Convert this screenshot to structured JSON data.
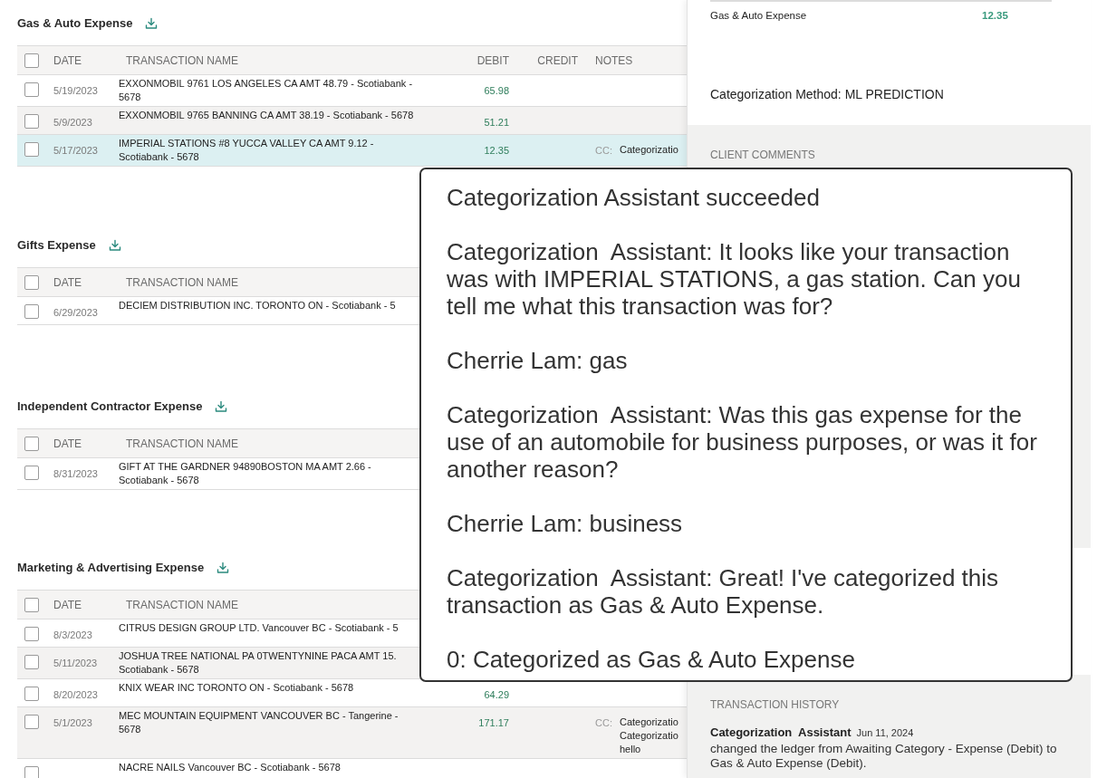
{
  "sections": [
    {
      "title": "Gas & Auto Expense",
      "columns": [
        "DATE",
        "TRANSACTION NAME",
        "DEBIT",
        "CREDIT",
        "NOTES"
      ],
      "header_checked": false,
      "rows": [
        {
          "date": "5/19/2023",
          "name": [
            "EXXONMOBIL 9761 LOS ANGELES CA AMT 48.79 - Scotiabank -",
            "5678"
          ],
          "debit": "65.98",
          "notes_label": "",
          "notes": [],
          "checked": false,
          "selected": false
        },
        {
          "date": "5/9/2023",
          "name": [
            "EXXONMOBIL 9765 BANNING CA AMT 38.19 - Scotiabank - 5678"
          ],
          "debit": "51.21",
          "notes_label": "",
          "notes": [],
          "checked": false,
          "selected": false
        },
        {
          "date": "5/17/2023",
          "name": [
            "IMPERIAL STATIONS #8 YUCCA VALLEY CA AMT 9.12 -",
            "Scotiabank - 5678"
          ],
          "debit": "12.35",
          "notes_label": "CC:",
          "notes": [
            "Categorizatio"
          ],
          "checked": false,
          "selected": true
        }
      ]
    },
    {
      "title": "Gifts Expense",
      "columns": [
        "DATE",
        "TRANSACTION NAME"
      ],
      "header_checked": false,
      "rows": [
        {
          "date": "6/29/2023",
          "name": [
            "DECIEM DISTRIBUTION INC. TORONTO ON - Scotiabank - 5"
          ],
          "debit": "",
          "notes_label": "",
          "notes": [],
          "checked": false,
          "selected": false
        }
      ]
    },
    {
      "title": "Independent Contractor Expense",
      "columns": [
        "DATE",
        "TRANSACTION NAME"
      ],
      "header_checked": false,
      "rows": [
        {
          "date": "8/31/2023",
          "name": [
            "GIFT AT THE GARDNER 94890BOSTON MA AMT 2.66 -",
            "Scotiabank - 5678"
          ],
          "debit": "",
          "notes_label": "",
          "notes": [],
          "checked": false,
          "selected": false
        }
      ]
    },
    {
      "title": "Marketing & Advertising Expense",
      "columns": [
        "DATE",
        "TRANSACTION NAME"
      ],
      "header_checked": false,
      "rows": [
        {
          "date": "8/3/2023",
          "name": [
            "CITRUS DESIGN GROUP LTD. Vancouver BC - Scotiabank - 5"
          ],
          "debit": "",
          "notes_label": "",
          "notes": [],
          "checked": false,
          "selected": false
        },
        {
          "date": "5/11/2023",
          "name": [
            "JOSHUA TREE NATIONAL PA 0TWENTYNINE PACA AMT 15.",
            "Scotiabank - 5678"
          ],
          "debit": "",
          "notes_label": "",
          "notes": [],
          "checked": false,
          "selected": false
        },
        {
          "date": "8/20/2023",
          "name": [
            "KNIX WEAR INC TORONTO ON - Scotiabank - 5678"
          ],
          "debit": "64.29",
          "notes_label": "",
          "notes": [],
          "checked": false,
          "selected": false
        },
        {
          "date": "5/1/2023",
          "name": [
            "MEC MOUNTAIN EQUIPMENT VANCOUVER BC - Tangerine -",
            "5678"
          ],
          "debit": "171.17",
          "notes_label": "CC:",
          "notes": [
            "Categorizatio",
            "Categorizatio",
            "hello"
          ],
          "checked": false,
          "selected": false
        },
        {
          "date": "",
          "name": [
            "NACRE NAILS Vancouver BC - Scotiabank - 5678"
          ],
          "debit": "",
          "notes_label": "",
          "notes": [],
          "checked": false,
          "selected": false
        }
      ]
    }
  ],
  "detail": {
    "ledger": "Gas & Auto Expense",
    "amount": "12.35",
    "method": "Categorization Method: ML PREDICTION",
    "comments_heading": "CLIENT COMMENTS",
    "history_heading": "TRANSACTION HISTORY",
    "history": [
      {
        "author": "Categorization  Assistant",
        "date": "Jun 11, 2024",
        "text": "changed the ledger from Awaiting Category - Expense (Debit) to Gas & Auto Expense (Debit)."
      }
    ]
  },
  "popup": {
    "messages": [
      "Categorization Assistant succeeded",
      "Categorization  Assistant: It looks like your transaction was with IMPERIAL STATIONS, a gas station. Can you tell me what this transaction was for?",
      "Cherrie Lam: gas",
      "Categorization  Assistant: Was this gas expense for the use of an automobile for business purposes, or was it for another reason?",
      "Cherrie Lam: business",
      "Categorization  Assistant: Great! I've categorized this transaction as Gas & Auto Expense.",
      "0: Categorized as Gas & Auto Expense"
    ]
  }
}
